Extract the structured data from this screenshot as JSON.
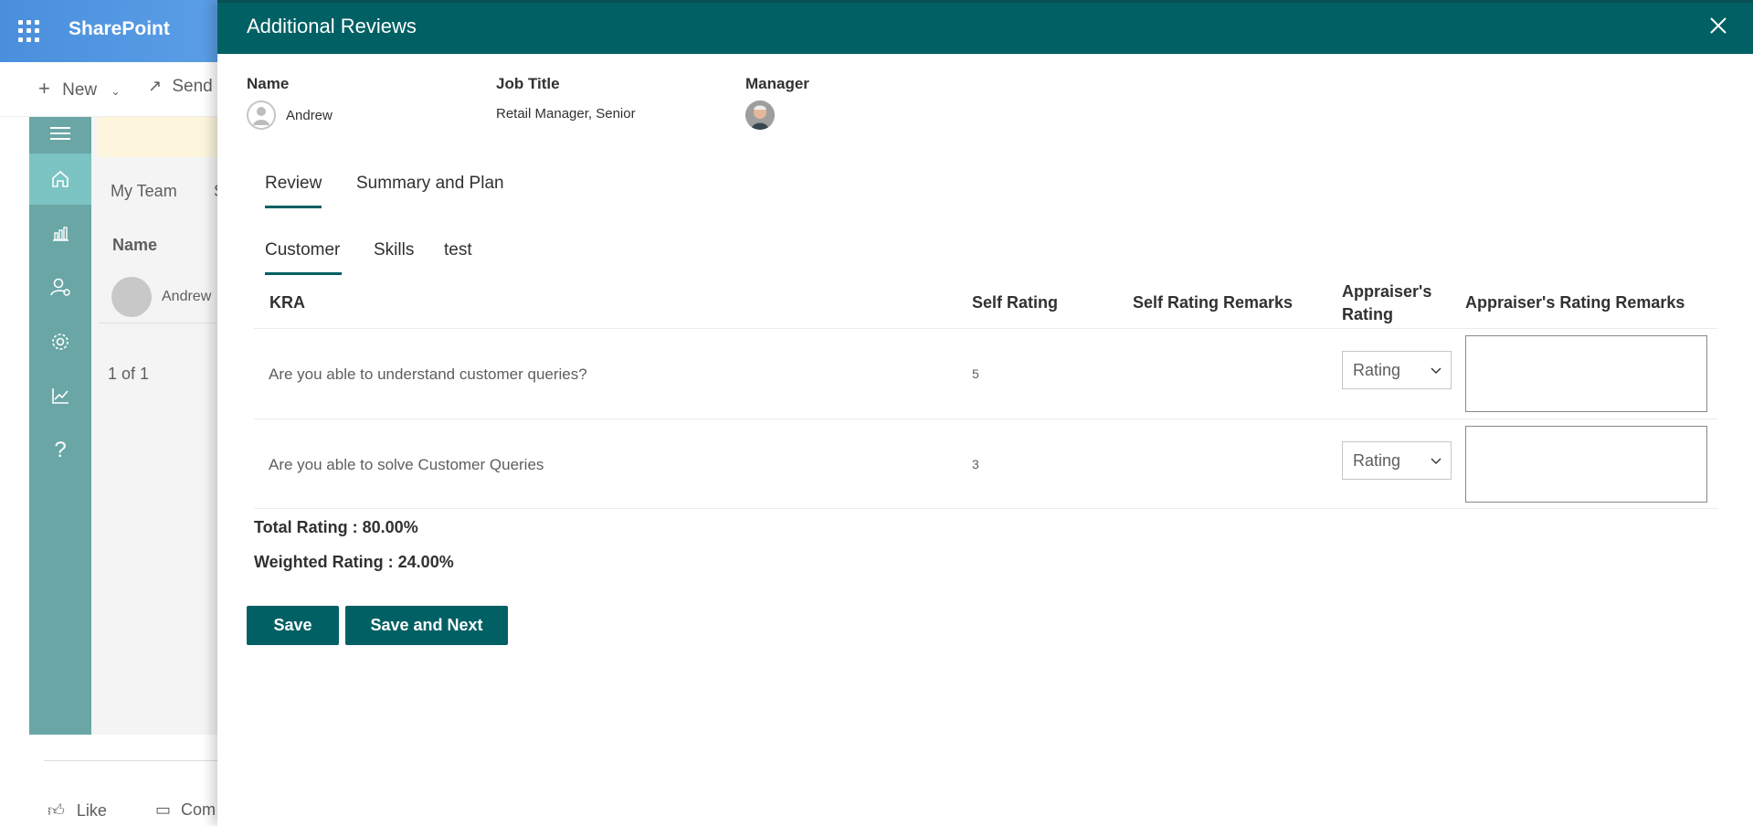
{
  "background": {
    "app_title": "SharePoint",
    "command_bar": {
      "new_label": "New",
      "send_label": "Send"
    },
    "tabs": {
      "my_team": "My Team",
      "next_tab_initial": "S"
    },
    "list_header_name": "Name",
    "list_row_name": "Andrew",
    "pager": "1 of 1",
    "footer": {
      "like": "Like",
      "comment": "Com"
    }
  },
  "panel": {
    "title": "Additional Reviews",
    "employee": {
      "name_label": "Name",
      "name_value": "Andrew",
      "job_title_label": "Job Title",
      "job_title_value": "Retail Manager, Senior",
      "manager_label": "Manager"
    },
    "main_tabs": [
      {
        "label": "Review",
        "active": true
      },
      {
        "label": "Summary and Plan",
        "active": false
      }
    ],
    "sub_tabs": [
      {
        "label": "Customer",
        "active": true
      },
      {
        "label": "Skills",
        "active": false
      },
      {
        "label": "test",
        "active": false
      }
    ],
    "table": {
      "headers": {
        "kra": "KRA",
        "self_rating": "Self Rating",
        "self_rating_remarks": "Self Rating Remarks",
        "appraiser_rating_line1": "Appraiser's",
        "appraiser_rating_line2": "Rating",
        "appraiser_rating_remarks": "Appraiser's Rating Remarks"
      },
      "rows": [
        {
          "kra": "Are you able to understand customer queries?",
          "self_rating": "5",
          "self_rating_remarks": "",
          "appraiser_rating_placeholder": "Rating",
          "appraiser_remarks": ""
        },
        {
          "kra": "Are you able to solve Customer Queries",
          "self_rating": "3",
          "self_rating_remarks": "",
          "appraiser_rating_placeholder": "Rating",
          "appraiser_remarks": ""
        }
      ]
    },
    "totals": {
      "total_rating": "Total Rating : 80.00%",
      "weighted_rating": "Weighted Rating : 24.00%"
    },
    "buttons": {
      "save": "Save",
      "save_next": "Save and Next"
    }
  },
  "colors": {
    "accent": "#006064",
    "rail": "#6aa6a6",
    "topbar": "#4a8fdc"
  },
  "icons": [
    "waffle-icon",
    "plus-icon",
    "chevron-down-icon",
    "send-icon",
    "hamburger-icon",
    "home-icon",
    "chart-icon",
    "user-settings-icon",
    "gear-icon",
    "trend-icon",
    "help-icon",
    "close-icon",
    "like-icon",
    "comment-icon",
    "person-icon"
  ]
}
